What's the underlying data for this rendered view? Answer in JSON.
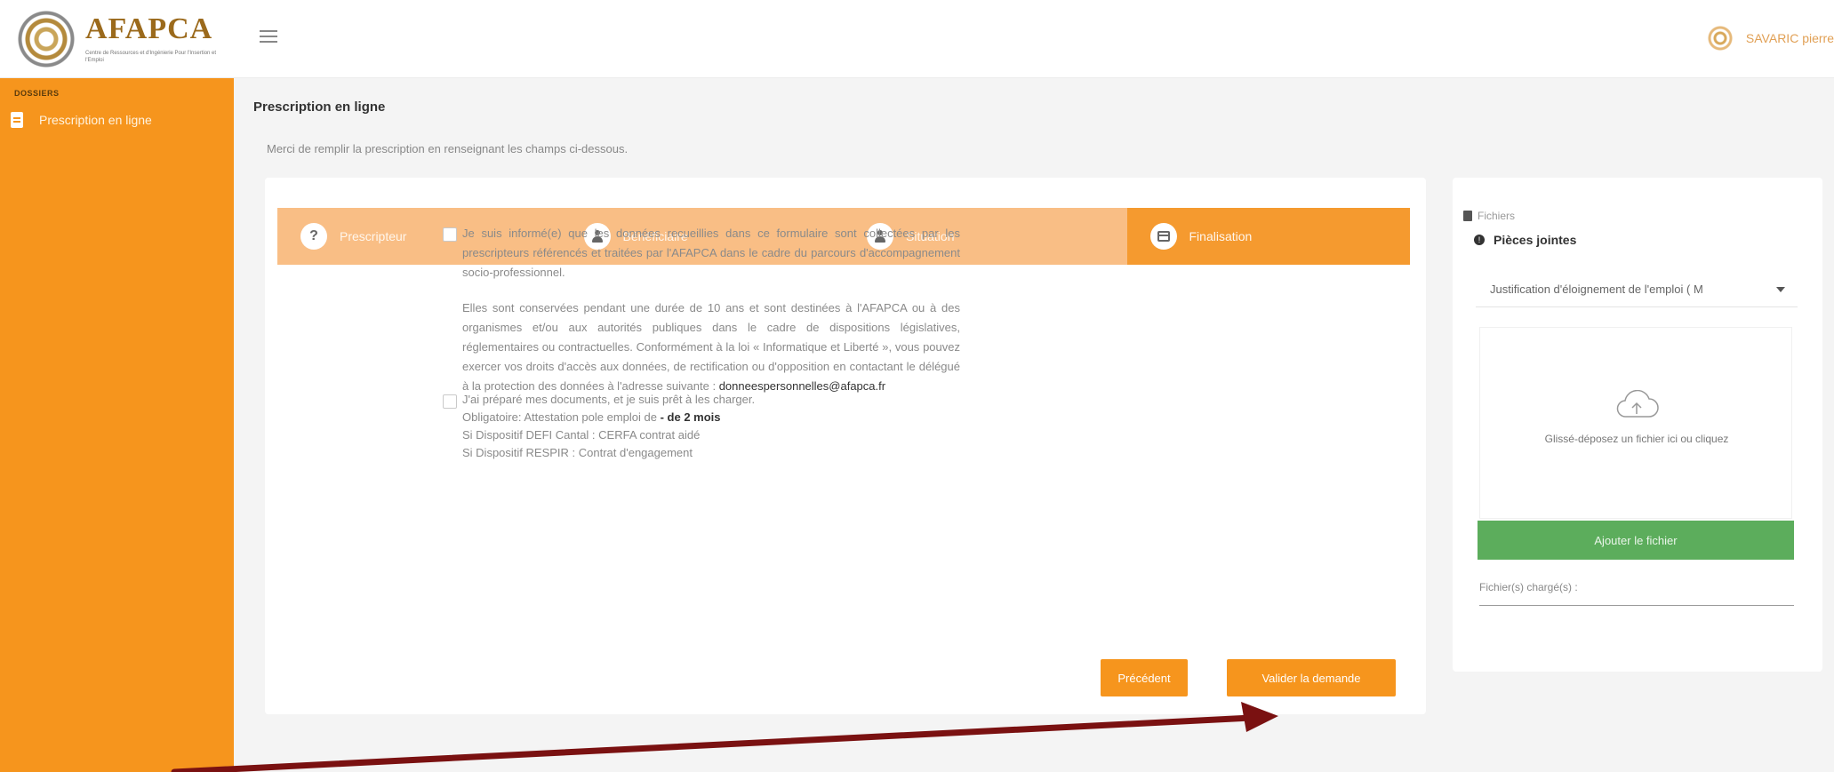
{
  "header": {
    "logo_title": "AFAPCA",
    "logo_subtitle": "Centre de Ressources et d'Ingénierie Pour l'Insertion et l'Emploi",
    "user_name": "SAVARIC pierre"
  },
  "sidebar": {
    "section_label": "DOSSIERS",
    "items": [
      {
        "label": "Prescription en ligne"
      }
    ]
  },
  "main": {
    "title": "Prescription en ligne",
    "subtitle": "Merci de remplir la prescription en renseignant les champs ci-dessous.",
    "steps": [
      {
        "label": "Prescripteur",
        "icon": "question-icon"
      },
      {
        "label": "Bénéficiaire",
        "icon": "person-icon"
      },
      {
        "label": "Situation",
        "icon": "person-icon"
      },
      {
        "label": "Finalisation",
        "icon": "calendar-icon",
        "active": true
      }
    ],
    "consent_1": {
      "p1": "Je suis informé(e) que les données recueillies dans ce formulaire sont collectées par les prescripteurs référencés et traitées par l'AFAPCA dans le cadre du parcours d'accompagnement socio-professionnel.",
      "p2": "Elles sont conservées pendant une durée de 10 ans et sont destinées à l'AFAPCA ou à des organismes et/ou aux autorités publiques dans le cadre de dispositions législatives, réglementaires ou contractuelles. Conformément à la loi « Informatique et Liberté », vous pouvez exercer vos droits d'accès aux données, de rectification ou d'opposition en contactant le délégué à la protection des données à l'adresse suivante :",
      "email": "donneespersonnelles@afapca.fr"
    },
    "consent_2": {
      "line1": "J'ai préparé mes documents, et je suis prêt à les charger.",
      "line2_prefix": "Obligatoire: Attestation pole emploi de",
      "line2_bold": "- de 2 mois",
      "line3": "Si Dispositif DEFI Cantal : CERFA contrat aidé",
      "line4": "Si Dispositif RESPIR : Contrat d'engagement"
    },
    "buttons": {
      "previous": "Précédent",
      "validate": "Valider la demande"
    }
  },
  "files": {
    "header_label": "Fichiers",
    "section_label": "Pièces jointes",
    "select_value": "Justification d'éloignement de l'emploi ( M",
    "dropzone_text": "Glissé-déposez un fichier ici ou cliquez",
    "add_button": "Ajouter le fichier",
    "loaded_label": "Fichier(s) chargé(s) :"
  },
  "colors": {
    "brand_orange": "#f6951d",
    "step_inactive": "#f9be85",
    "green": "#5cad5c",
    "annotation_arrow": "#7a1111"
  }
}
